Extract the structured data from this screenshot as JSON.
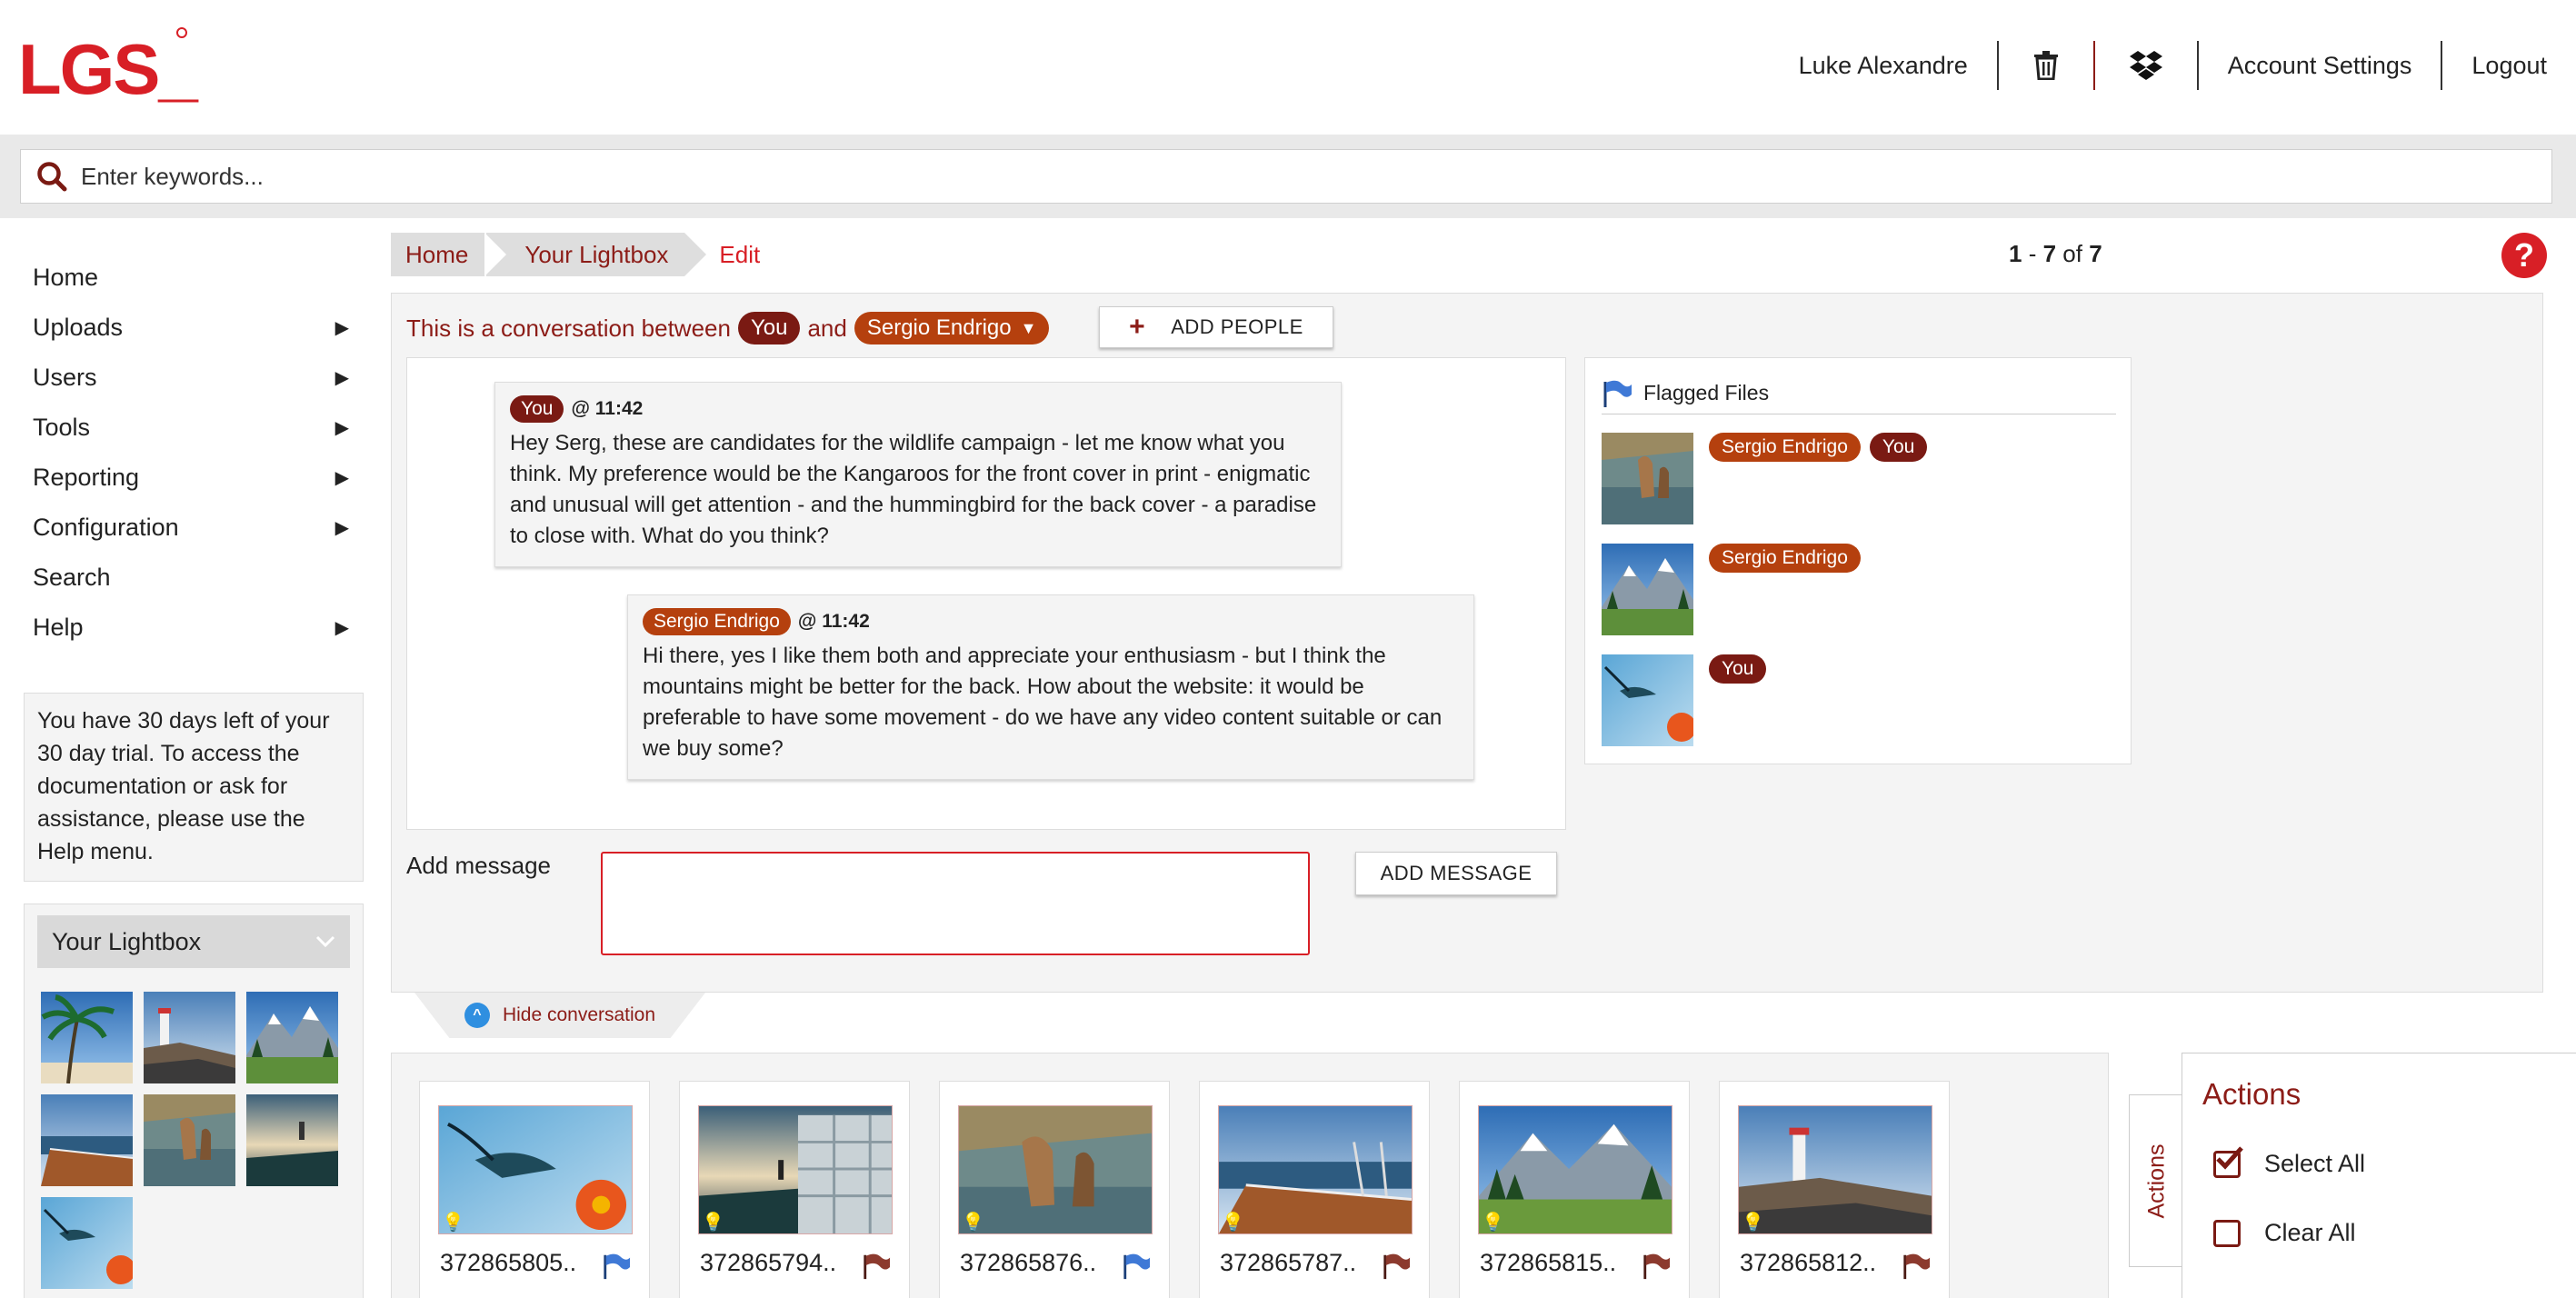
{
  "brand": {
    "logo": "LGS_",
    "accent": "#8c1c17",
    "brand_red": "#d81f26"
  },
  "topnav": {
    "user": "Luke Alexandre",
    "trash_icon": "trash-icon",
    "dropbox_icon": "dropbox-icon",
    "account_settings": "Account Settings",
    "logout": "Logout"
  },
  "search": {
    "placeholder": "Enter keywords..."
  },
  "sidebar": {
    "items": [
      {
        "label": "Home",
        "has_submenu": false
      },
      {
        "label": "Uploads",
        "has_submenu": true
      },
      {
        "label": "Users",
        "has_submenu": true
      },
      {
        "label": "Tools",
        "has_submenu": true
      },
      {
        "label": "Reporting",
        "has_submenu": true
      },
      {
        "label": "Configuration",
        "has_submenu": true
      },
      {
        "label": "Search",
        "has_submenu": false
      },
      {
        "label": "Help",
        "has_submenu": true
      }
    ],
    "trial_text": "You have 30 days left of your 30 day trial. To access the documentation or ask for assistance, please use the Help menu.",
    "lightbox_title": "Your Lightbox",
    "lightbox_thumbs": [
      "palm-beach",
      "lighthouse-coast",
      "mountain-lake",
      "boat-deck",
      "kangaroo-water",
      "ocean-railing",
      "hummingbird"
    ]
  },
  "breadcrumb": {
    "home": "Home",
    "lightbox": "Your Lightbox",
    "edit": "Edit"
  },
  "paging": {
    "start": "1",
    "end": "7",
    "total": "7",
    "of": "of"
  },
  "conversation": {
    "intro": "This is a conversation between",
    "and": "and",
    "you": "You",
    "other": "Sergio Endrigo",
    "add_people": "ADD PEOPLE",
    "messages": [
      {
        "author": "You",
        "time": "@ 11:42",
        "text": "Hey Serg, these are candidates for the wildlife campaign - let me know what you think. My preference would be the Kangaroos for the front cover in print - enigmatic and unusual will get attention - and the hummingbird for the back cover - a paradise to close with. What do you think?"
      },
      {
        "author": "Sergio Endrigo",
        "time": "@ 11:42",
        "text": "Hi there, yes I like them both and appreciate your enthusiasm - but I think the mountains might be better for the back. How about the website: it would be preferable to have some movement - do we have any video content suitable or can we buy some?"
      }
    ],
    "flagged_title": "Flagged Files",
    "flagged": [
      {
        "image": "kangaroo-water",
        "people": [
          "Sergio Endrigo",
          "You"
        ]
      },
      {
        "image": "mountain-lake",
        "people": [
          "Sergio Endrigo"
        ]
      },
      {
        "image": "hummingbird",
        "people": [
          "You"
        ]
      }
    ],
    "add_message_label": "Add message",
    "add_message_button": "ADD MESSAGE",
    "hide": "Hide conversation"
  },
  "files": [
    {
      "name": "372865805..",
      "image": "hummingbird",
      "flag": "blue"
    },
    {
      "name": "372865794..",
      "image": "ocean-railing",
      "flag": "red"
    },
    {
      "name": "372865876..",
      "image": "kangaroo-water",
      "flag": "blue"
    },
    {
      "name": "372865787..",
      "image": "boat-deck",
      "flag": "red"
    },
    {
      "name": "372865815..",
      "image": "mountain-lake",
      "flag": "red"
    },
    {
      "name": "372865812..",
      "image": "lighthouse-coast",
      "flag": "red"
    }
  ],
  "actions": {
    "tab": "Actions",
    "title": "Actions",
    "select_all": "Select All",
    "clear_all": "Clear All"
  }
}
